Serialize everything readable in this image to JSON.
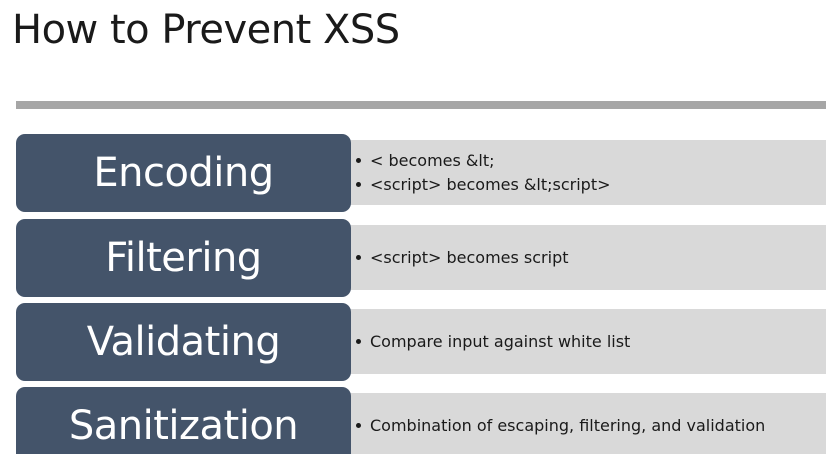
{
  "slide": {
    "title": "How to Prevent XSS",
    "rows": [
      {
        "label": "Encoding",
        "bullets": [
          "< becomes &lt;",
          "<script> becomes &lt;script>"
        ]
      },
      {
        "label": "Filtering",
        "bullets": [
          "<script> becomes script"
        ]
      },
      {
        "label": "Validating",
        "bullets": [
          "Compare input against white list"
        ]
      },
      {
        "label": "Sanitization",
        "bullets": [
          "Combination of escaping, filtering, and validation"
        ]
      }
    ]
  },
  "colors": {
    "label_box": "#44546a",
    "bullet_band": "#d9d9d9",
    "divider": "#a6a6a6",
    "text": "#1a1a1a"
  }
}
